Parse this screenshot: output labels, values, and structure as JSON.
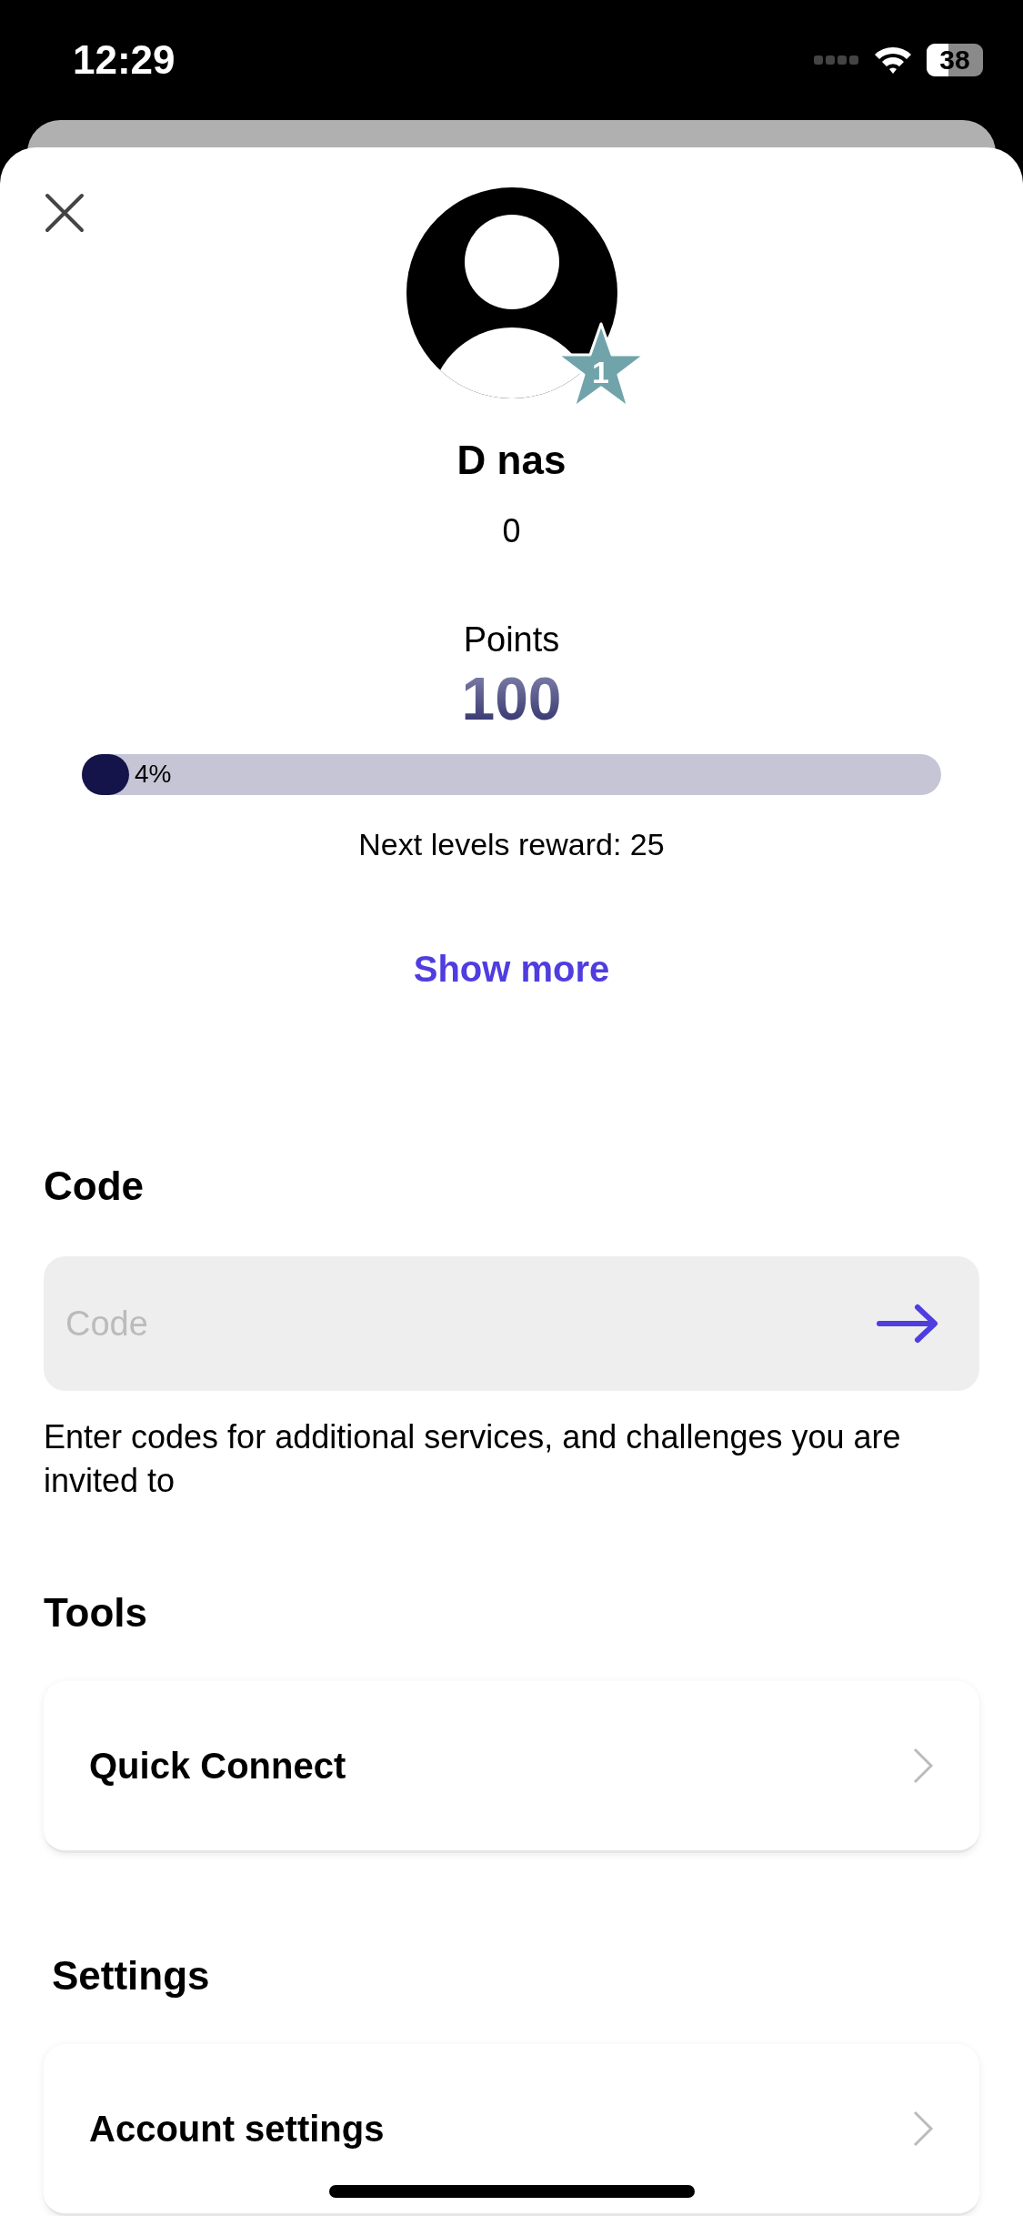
{
  "status_bar": {
    "time": "12:29",
    "battery": "38"
  },
  "profile": {
    "name": "D nas",
    "level_badge": "1",
    "subtitle": "0",
    "points_label": "Points",
    "points": "100",
    "progress": {
      "level": 0.04,
      "reading": "4%"
    },
    "next_reward": "Next levels reward: 25",
    "show_more": "Show more"
  },
  "code": {
    "heading": "Code",
    "field": {
      "placeholder": "Code"
    },
    "description": "Enter codes for additional services, and challenges you are invited to"
  },
  "tools": {
    "heading": "Tools",
    "items": [
      {
        "label": "Quick Connect",
        "kind": "nav"
      }
    ]
  },
  "settings": {
    "heading": "Settings",
    "items": [
      {
        "label": "Account settings",
        "kind": "nav"
      }
    ]
  }
}
